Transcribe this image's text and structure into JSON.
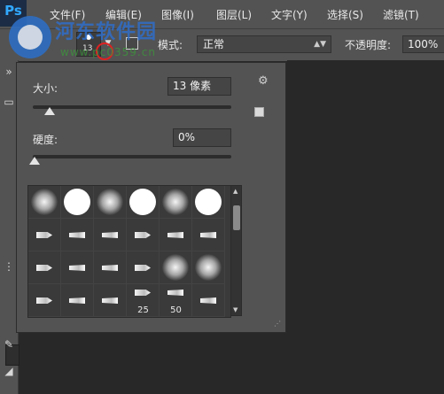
{
  "app": {
    "logo_text": "Ps"
  },
  "menu": [
    "文件(F)",
    "编辑(E)",
    "图像(I)",
    "图层(L)",
    "文字(Y)",
    "选择(S)",
    "滤镜(T)"
  ],
  "options_bar": {
    "brush_size": "13",
    "mode_label": "模式:",
    "mode_value": "正常",
    "opacity_label": "不透明度:",
    "opacity_value": "100%"
  },
  "brush_popup": {
    "size_label": "大小:",
    "size_value": "13 像素",
    "size_slider_fraction": 0.05,
    "hardness_label": "硬度:",
    "hardness_value": "0%",
    "hardness_slider_fraction": 0.0,
    "presets": [
      {
        "kind": "soft"
      },
      {
        "kind": "hard"
      },
      {
        "kind": "soft"
      },
      {
        "kind": "hard"
      },
      {
        "kind": "soft"
      },
      {
        "kind": "hard"
      },
      {
        "kind": "tip"
      },
      {
        "kind": "tip"
      },
      {
        "kind": "tip"
      },
      {
        "kind": "tip"
      },
      {
        "kind": "tip"
      },
      {
        "kind": "tip"
      },
      {
        "kind": "tip"
      },
      {
        "kind": "tip"
      },
      {
        "kind": "tip"
      },
      {
        "kind": "tip"
      },
      {
        "kind": "soft"
      },
      {
        "kind": "soft"
      },
      {
        "kind": "tip"
      },
      {
        "kind": "tip"
      },
      {
        "kind": "tip"
      },
      {
        "kind": "tip",
        "label": "25"
      },
      {
        "kind": "tip",
        "label": "50"
      },
      {
        "kind": "tip"
      }
    ]
  },
  "watermark": {
    "text": "河东软件园",
    "url": "www.pc0359.cn"
  },
  "colors": {
    "panel": "#535353",
    "canvas": "#282828",
    "accent_red": "#d22222",
    "watermark_blue": "#2e6fcd"
  },
  "icons": [
    "brush-preview-icon",
    "dropdown-arrow-icon",
    "brush-panel-icon",
    "gear-icon",
    "new-preset-icon",
    "resize-grip-icon"
  ]
}
